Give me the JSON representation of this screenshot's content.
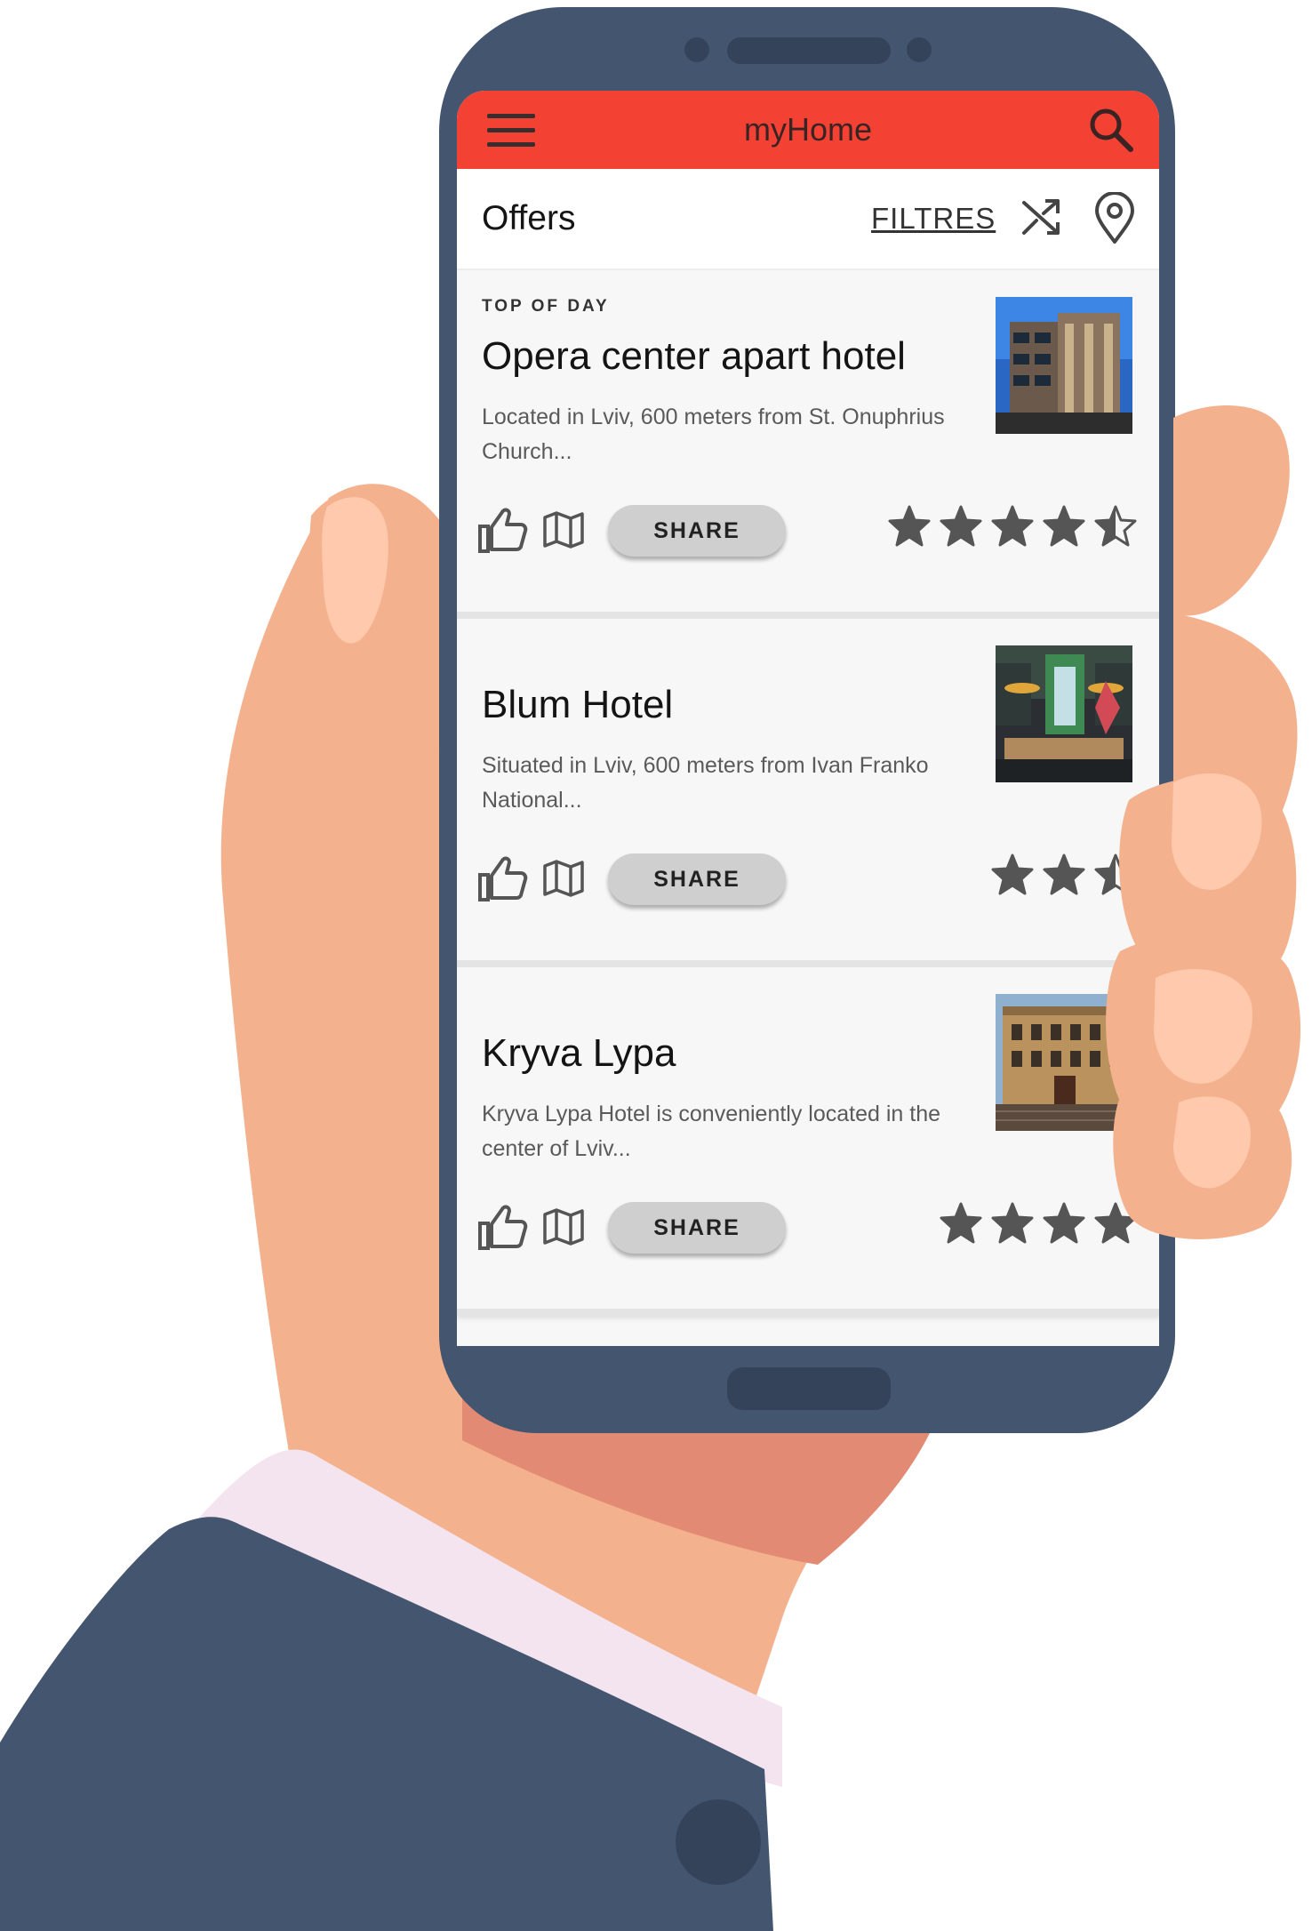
{
  "colors": {
    "brand": "#f34133",
    "phone": "#44566f",
    "skin": "#f4b18d",
    "sleeve": "#44566f",
    "cuff": "#f3e4ef",
    "star": "#555555"
  },
  "app_bar": {
    "title": "myHome",
    "menu_icon": "hamburger-menu-icon",
    "search_icon": "search-icon"
  },
  "subheader": {
    "title": "Offers",
    "filters_label": "FILTRES",
    "shuffle_icon": "shuffle-icon",
    "location_icon": "location-pin-icon"
  },
  "offers": [
    {
      "tag": "TOP OF DAY",
      "name": "Opera center apart hotel",
      "description": "Located in Lviv, 600 meters from St. Onuphrius Church...",
      "share_label": "SHARE",
      "rating": 4.5
    },
    {
      "tag": "",
      "name": "Blum Hotel",
      "description": "Situated in Lviv, 600 meters from Ivan Franko National...",
      "share_label": "SHARE",
      "rating": 2.5
    },
    {
      "tag": "",
      "name": "Kryva Lypa",
      "description": "Kryva Lypa Hotel is conveniently located in the center of Lviv...",
      "share_label": "SHARE",
      "rating": 4
    }
  ]
}
